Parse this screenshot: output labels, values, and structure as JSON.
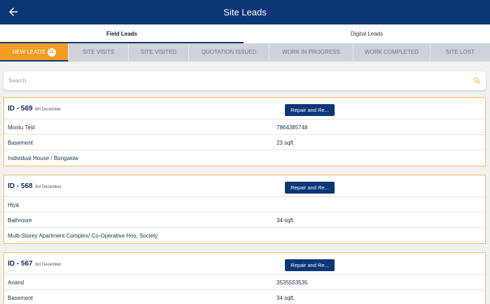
{
  "appbar": {
    "title": "Site Leads",
    "back_icon": "arrow-left-icon"
  },
  "segments": [
    {
      "label": "Field Leads",
      "active": true
    },
    {
      "label": "Digital Leads",
      "active": false
    }
  ],
  "statuses": [
    {
      "label": "NEW LEADS",
      "badge": "11",
      "active": true
    },
    {
      "label": "SITE VISITS"
    },
    {
      "label": "SITE VISITED"
    },
    {
      "label": "QUOTATION ISSUED"
    },
    {
      "label": "WORK IN PROGRESS"
    },
    {
      "label": "WORK COMPLETED"
    },
    {
      "label": "SITE LOST"
    }
  ],
  "search": {
    "placeholder": "Search",
    "icon": "search-icon"
  },
  "leads": [
    {
      "id": "ID - 569",
      "date": "4th December",
      "action": "Repair and Re...",
      "name": "Montu Test",
      "phone": "7864385748",
      "area": "Basement",
      "size": "23 sqft.",
      "property": "Individual House / Bungalow"
    },
    {
      "id": "ID - 568",
      "date": "3rd December",
      "action": "Repair and Re...",
      "name": "Hiya",
      "phone": "",
      "area": "Bathroom",
      "size": "34 sqft.",
      "property": "Multi-Storey Apartment Complex/ Co-Operative Hos. Society"
    },
    {
      "id": "ID - 567",
      "date": "3rd December",
      "action": "Repair and Re...",
      "name": "Anand",
      "phone": "3535553535",
      "area": "Basement",
      "size": "34 sqft.",
      "property": ""
    }
  ],
  "colors": {
    "primary": "#0d3677",
    "accent": "#f29c25",
    "card_border": "#f2bd63"
  }
}
